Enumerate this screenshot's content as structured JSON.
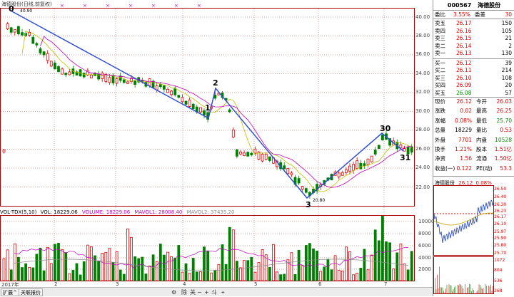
{
  "chart": {
    "title": "海德股份(日线,前复权)",
    "max_price_marker": "40.90",
    "min_price_marker": "20.80",
    "price_axis": [
      "40.00",
      "38.00",
      "36.00",
      "34.00",
      "32.00",
      "30.00",
      "28.00",
      "26.00",
      "24.00",
      "22.00"
    ],
    "volume_axis": [
      "10000",
      "8000",
      "6000",
      "4000",
      "2000"
    ],
    "x_axis": [
      "2017年",
      "2",
      "3",
      "4",
      "5",
      "6",
      "7"
    ],
    "indicator": {
      "name": "VOL-TDX(5,10)",
      "vol": "VOL: 18229.06",
      "volume": "VOLUME: 18229.06",
      "mavol1": "MAVOL1: 28008.40",
      "mavol2": "MAVOL2: 37435.20"
    },
    "wave_labels": [
      "0",
      "1",
      "2",
      "3",
      "30",
      "31"
    ]
  },
  "toolbar": {
    "expand_label": "扩展^",
    "related_label": "关联报价",
    "nav_items": [
      "除",
      "关",
      "斗",
      "小"
    ]
  },
  "panel": {
    "code": "000567",
    "name": "海德股份",
    "wei": {
      "ratio_label": "委比",
      "ratio": "3.55%",
      "diff_label": "委差",
      "diff": "30"
    },
    "asks": [
      {
        "label": "卖五",
        "price": "26.17",
        "vol": "150"
      },
      {
        "label": "卖四",
        "price": "26.16",
        "vol": "105"
      },
      {
        "label": "卖三",
        "price": "26.15",
        "vol": "21"
      },
      {
        "label": "卖二",
        "price": "26.14",
        "vol": "2"
      },
      {
        "label": "卖一",
        "price": "26.13",
        "vol": "130"
      }
    ],
    "bids": [
      {
        "label": "买一",
        "price": "26.12",
        "vol": "39"
      },
      {
        "label": "买二",
        "price": "26.11",
        "vol": "214"
      },
      {
        "label": "买三",
        "price": "26.10",
        "vol": "108"
      },
      {
        "label": "买四",
        "price": "26.09",
        "vol": "20"
      },
      {
        "label": "买五",
        "price": "26.08",
        "vol": "57"
      }
    ],
    "stats": [
      {
        "l1": "现价",
        "v1": "26.12",
        "l2": "今开",
        "v2": "26.03"
      },
      {
        "l1": "涨跌",
        "v1": "0.02",
        "l2": "最高",
        "v2": "26.25"
      },
      {
        "l1": "涨幅",
        "v1": "0.08%",
        "l2": "最低",
        "v2": "25.70"
      },
      {
        "l1": "总量",
        "v1": "18229",
        "l2": "量比",
        "v2": "0.53"
      },
      {
        "l1": "外盘",
        "v1": "7701",
        "l2": "内盘",
        "v2": "10528"
      },
      {
        "l1": "换手",
        "v1": "1.21%",
        "l2": "股本",
        "v2": "1.51亿"
      },
      {
        "l1": "净资",
        "v1": "1.56",
        "l2": "流通",
        "v2": "1.50亿"
      },
      {
        "l1": "收益(一)",
        "v1": "0.122",
        "l2": "PE(动)",
        "v2": "53.3"
      }
    ],
    "mini": {
      "title": "海德股份",
      "price": "26.12",
      "pct": "0.08%",
      "price_axis": [
        "26.50",
        "26.40",
        "26.30",
        "26.23",
        "26.17",
        "26.10",
        "25.97",
        "25.90",
        "25.80",
        "25.70"
      ],
      "vol_axis": [
        "1072",
        "804",
        "536",
        "268"
      ]
    }
  }
}
